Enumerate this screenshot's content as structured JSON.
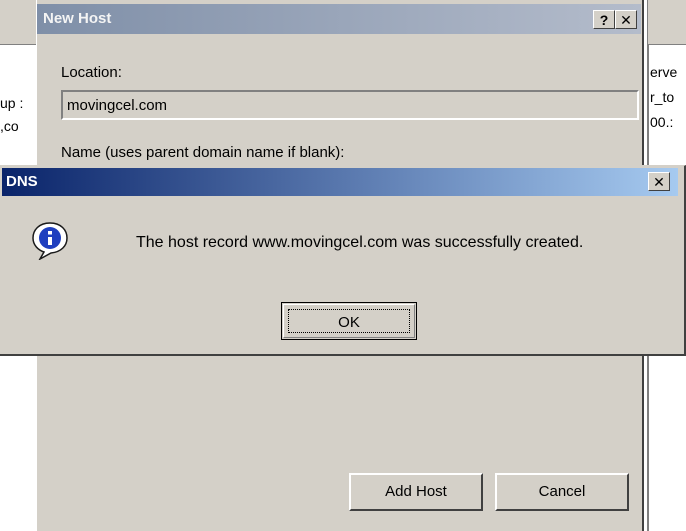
{
  "background": {
    "left_fragments": [
      "up :",
      ",co",
      ""
    ],
    "right_fragments": [
      "erve",
      "r_to",
      "00.:"
    ]
  },
  "new_host": {
    "title": "New Host",
    "help_button": "?",
    "close_button": "✕",
    "location_label": "Location:",
    "location_value": "movingcel.com",
    "name_label": "Name (uses parent domain name if blank):",
    "add_host_button": "Add Host",
    "cancel_button": "Cancel"
  },
  "dns_dialog": {
    "title": "DNS",
    "close_button": "✕",
    "icon": "information-icon",
    "message": "The host record www.movingcel.com was successfully created.",
    "ok_button": "OK"
  },
  "colors": {
    "dns_titlebar_start": "#0a246a",
    "dns_titlebar_end": "#a6caf0",
    "inactive_titlebar": "#7f8fa8",
    "dialog_face": "#d4d0c8"
  }
}
